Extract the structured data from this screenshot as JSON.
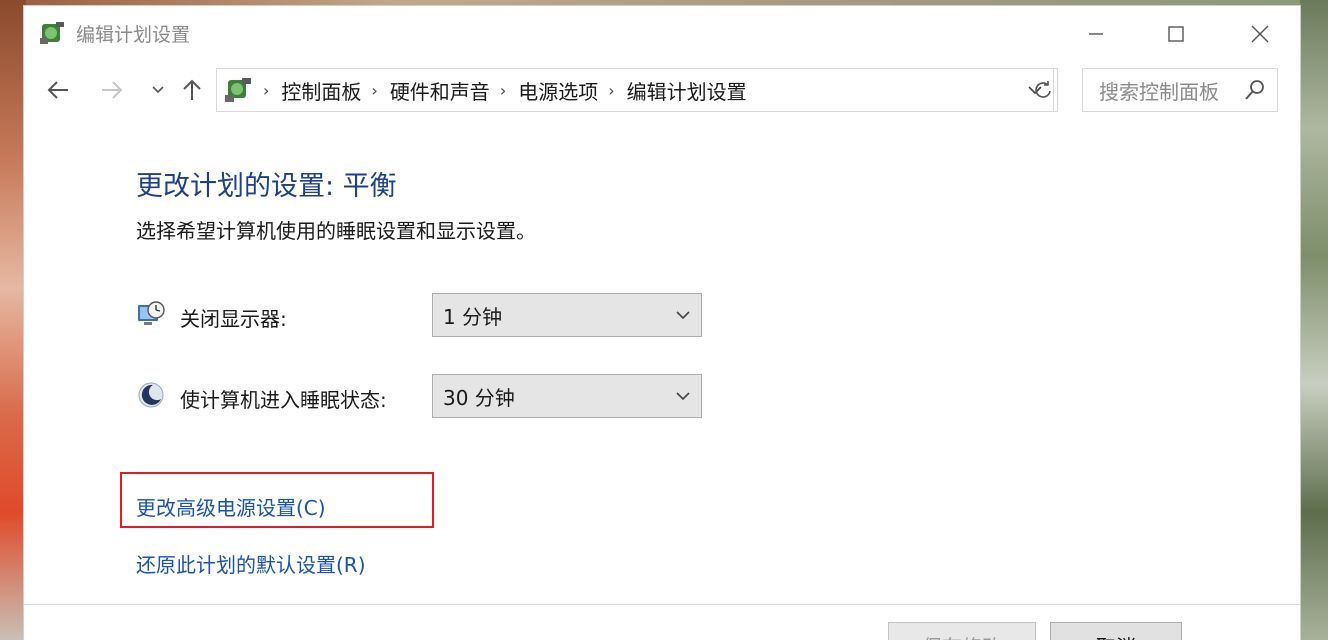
{
  "window": {
    "title": "编辑计划设置",
    "minimize_icon": "minimize-icon",
    "maximize_icon": "maximize-icon",
    "close_icon": "close-icon"
  },
  "nav": {
    "breadcrumbs": [
      "控制面板",
      "硬件和声音",
      "电源选项",
      "编辑计划设置"
    ],
    "search_placeholder": "搜索控制面板"
  },
  "main": {
    "title": "更改计划的设置: 平衡",
    "subtitle": "选择希望计算机使用的睡眠设置和显示设置。",
    "settings": [
      {
        "label": "关闭显示器:",
        "value": "1 分钟",
        "icon": "monitor-clock-icon"
      },
      {
        "label": "使计算机进入睡眠状态:",
        "value": "30 分钟",
        "icon": "moon-icon"
      }
    ],
    "links": {
      "advanced": "更改高级电源设置(C)",
      "restore": "还原此计划的默认设置(R)"
    }
  },
  "footer": {
    "save_label": "保存修改",
    "cancel_label": "取消"
  },
  "colors": {
    "title": "#1e3f8a",
    "link": "#1a52b0",
    "highlight": "#d9202a"
  }
}
